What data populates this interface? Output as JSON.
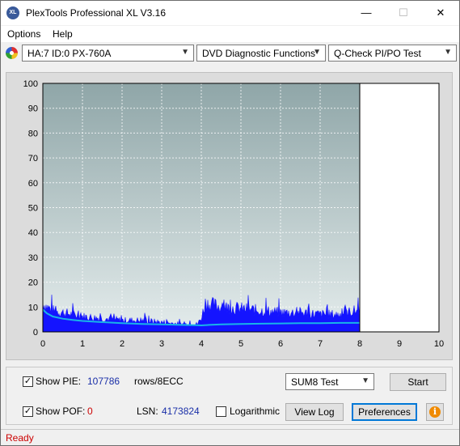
{
  "window": {
    "title": "PlexTools Professional XL V3.16",
    "app_icon_text": "XL",
    "minimize": "—",
    "maximize": "☐",
    "close": "✕"
  },
  "menu": {
    "options": "Options",
    "help": "Help"
  },
  "toolbar": {
    "drive": "HA:7 ID:0  PX-760A",
    "function": "DVD Diagnostic Functions",
    "test": "Q-Check PI/PO Test"
  },
  "chart_data": {
    "type": "area",
    "title": "",
    "xlabel": "",
    "ylabel": "",
    "xlim": [
      0,
      10
    ],
    "ylim": [
      0,
      100
    ],
    "x_ticks": [
      0,
      1,
      2,
      3,
      4,
      5,
      6,
      7,
      8,
      9,
      10
    ],
    "y_ticks": [
      0,
      10,
      20,
      30,
      40,
      50,
      60,
      70,
      80,
      90,
      100
    ],
    "test_end_x": 8,
    "colors": {
      "plot_bg_top": "#8fa6a8",
      "plot_bg_bottom": "#e4ecec",
      "pie_fill": "#1414ff",
      "average_line": "#18b4e8",
      "unscanned_bg": "#ffffff"
    },
    "series": [
      {
        "name": "PIE",
        "style": "spikes",
        "x": [
          0,
          0.1,
          0.25,
          0.5,
          0.75,
          1,
          1.5,
          2,
          2.5,
          3,
          3.5,
          3.9,
          4.0,
          4.1,
          4.3,
          4.5,
          5,
          5.5,
          6,
          6.5,
          7,
          7.5,
          7.9,
          8
        ],
        "y": [
          15,
          13,
          11,
          10,
          9,
          8,
          7,
          6,
          6,
          5,
          4,
          4,
          7,
          15,
          14,
          13,
          12,
          11,
          10,
          10,
          9,
          9,
          11,
          12
        ]
      },
      {
        "name": "PIE average",
        "style": "line",
        "x": [
          0,
          0.1,
          0.25,
          0.5,
          0.75,
          1,
          1.5,
          2,
          2.5,
          3,
          3.5,
          3.9,
          4.0,
          4.2,
          4.5,
          5,
          5.5,
          6,
          6.5,
          7,
          7.5,
          8
        ],
        "y": [
          9,
          7.5,
          6.2,
          5.3,
          4.8,
          4.4,
          3.9,
          3.5,
          3.2,
          3.0,
          2.8,
          2.7,
          2.6,
          2.8,
          3.0,
          3.2,
          3.3,
          3.4,
          3.5,
          3.5,
          3.6,
          3.6
        ]
      }
    ]
  },
  "controls": {
    "show_pie_label": "Show PIE:",
    "pie_value": "107786",
    "pie_unit": "rows/8ECC",
    "show_pof_label": "Show POF:",
    "pof_value": "0",
    "lsn_label": "LSN:",
    "lsn_value": "4173824",
    "logarithmic_label": "Logarithmic",
    "test_mode": "SUM8 Test",
    "start": "Start",
    "view_log": "View Log",
    "preferences": "Preferences",
    "show_pie_checked": "✓",
    "show_pof_checked": "✓"
  },
  "status": {
    "text": "Ready"
  }
}
